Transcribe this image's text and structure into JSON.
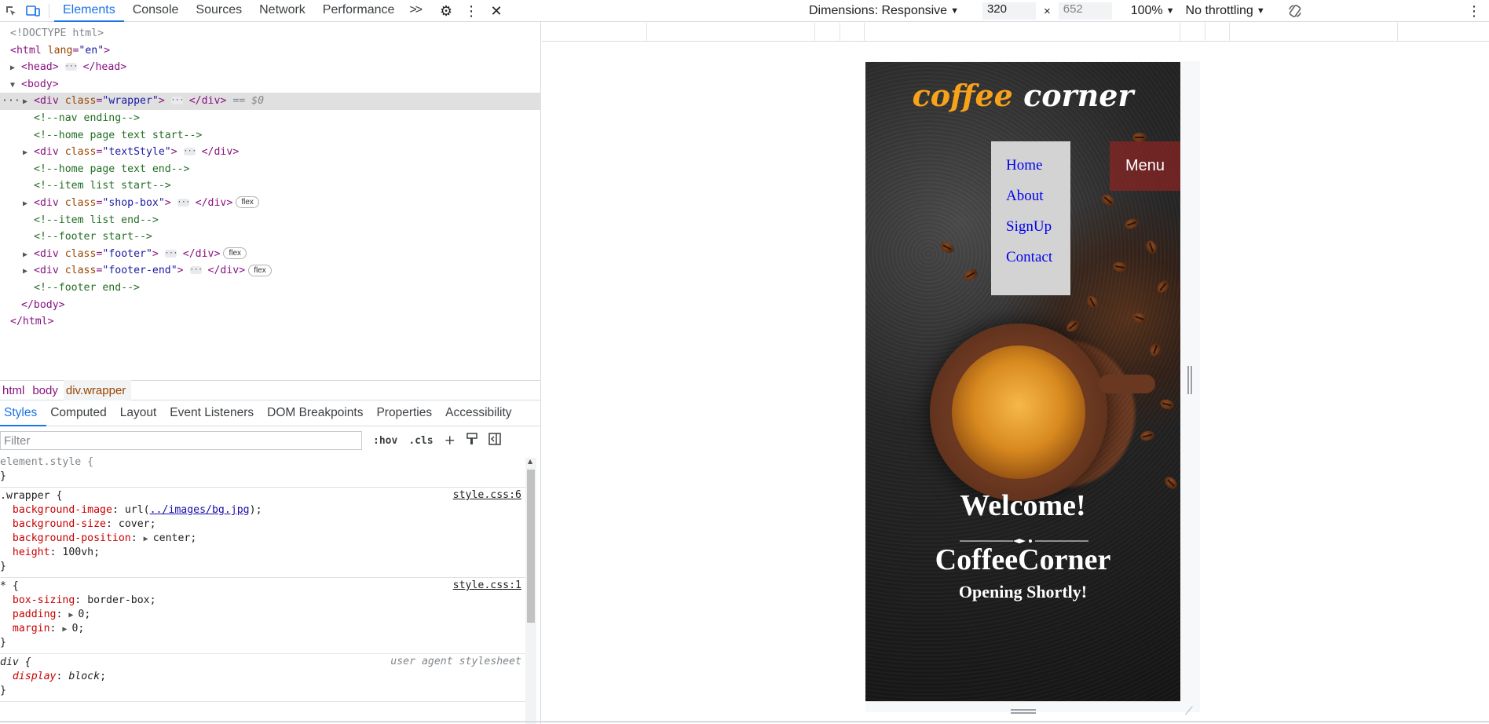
{
  "toolbar": {
    "tabs": [
      "Elements",
      "Console",
      "Sources",
      "Network",
      "Performance"
    ],
    "more_tabs": ">>"
  },
  "device": {
    "dimensions_label": "Dimensions: Responsive",
    "width": "320",
    "height_placeholder": "652",
    "zoom": "100%",
    "throttling": "No throttling"
  },
  "dom": {
    "doctype": "<!DOCTYPE html>",
    "html_open_tag": "html",
    "html_attr": "lang",
    "html_lang": "\"en\"",
    "head": "head",
    "body": "body",
    "wrapper_class": "\"wrapper\"",
    "selected_marker": "== $0",
    "comment_nav_end": "<!--nav ending-->",
    "comment_home_start": "<!--home page text start-->",
    "textstyle_class": "\"textStyle\"",
    "comment_home_end": "<!--home page text end-->",
    "comment_item_start": "<!--item list start-->",
    "shopbox_class": "\"shop-box\"",
    "comment_item_end": "<!--item list end-->",
    "comment_footer_start": "<!--footer start-->",
    "footer_class": "\"footer\"",
    "footerend_class": "\"footer-end\"",
    "comment_footer_end": "<!--footer end-->",
    "badge_flex": "flex"
  },
  "breadcrumbs": [
    "html",
    "body",
    "div.wrapper"
  ],
  "style_tabs": [
    "Styles",
    "Computed",
    "Layout",
    "Event Listeners",
    "DOM Breakpoints",
    "Properties",
    "Accessibility"
  ],
  "filter": {
    "placeholder": "Filter",
    "hov": ":hov",
    "cls": ".cls"
  },
  "styles": {
    "element_style": "element.style {",
    "close": "}",
    "wrapper_selector": ".wrapper {",
    "wrapper_src": "style.css:6",
    "bg_image_prop": "background-image",
    "bg_image_link": "../images/bg.jpg",
    "bg_size_prop": "background-size",
    "bg_size_val": "cover",
    "bg_pos_prop": "background-position",
    "bg_pos_val": "center",
    "height_prop": "height",
    "height_val": "100vh",
    "star_selector": "* {",
    "star_src": "style.css:1",
    "boxsizing_prop": "box-sizing",
    "boxsizing_val": "border-box",
    "padding_prop": "padding",
    "padding_val": "0",
    "margin_prop": "margin",
    "margin_val": "0",
    "div_selector": "div {",
    "ua_src": "user agent stylesheet",
    "display_prop": "display",
    "display_val": "block"
  },
  "site": {
    "logo_part1": "coffee",
    "logo_part2": "corner",
    "nav": [
      "Home",
      "About",
      "SignUp",
      "Contact"
    ],
    "menu_label": "Menu",
    "welcome": "Welcome!",
    "brand": "CoffeeCorner",
    "tagline": "Opening Shortly!"
  }
}
